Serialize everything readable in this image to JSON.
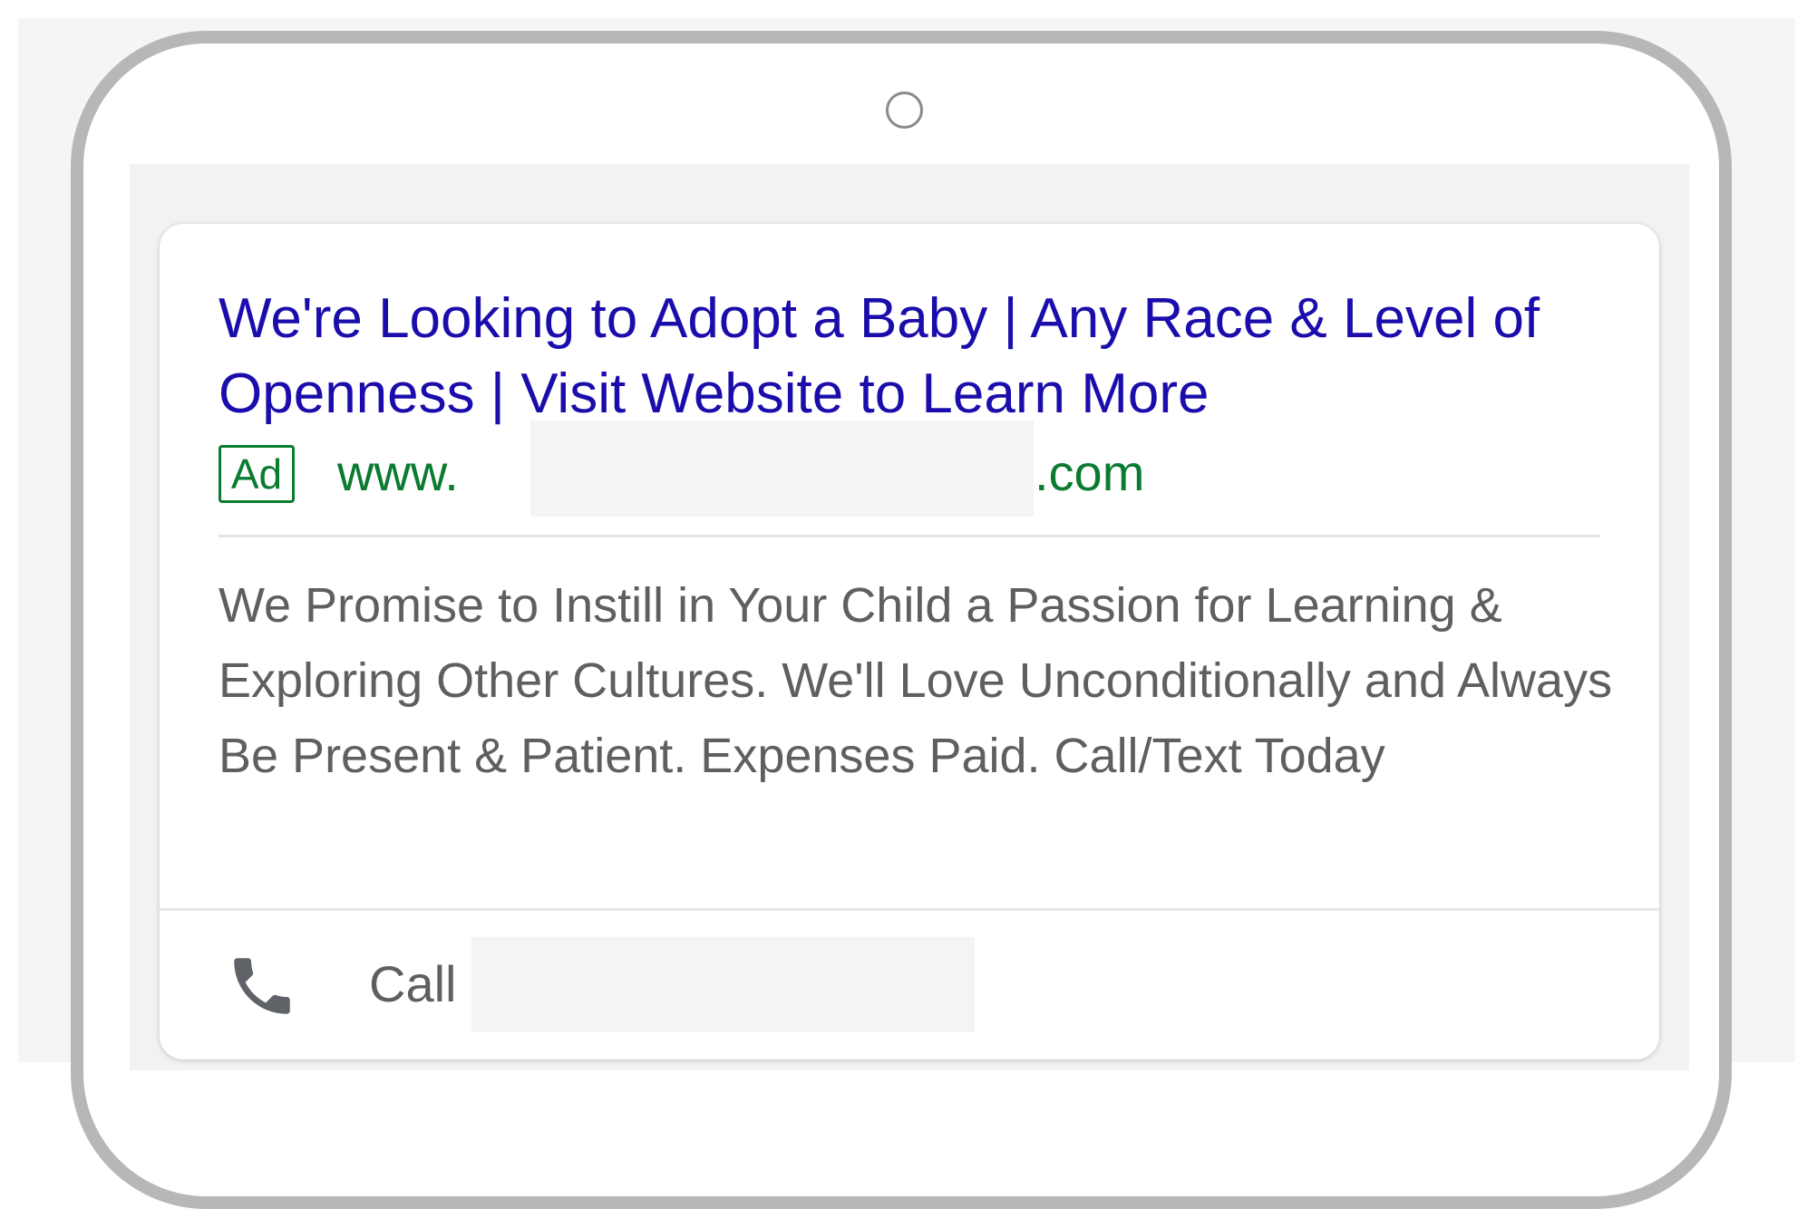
{
  "ad": {
    "headline": "We're Looking to Adopt a Baby | Any Race & Level of Openness | Visit Website to Learn More",
    "badge": "Ad",
    "display_url_prefix": "www.",
    "display_url_suffix": ".com",
    "description": "We Promise to Instill in Your Child a Passion for Learning & Exploring Other Cultures. We'll Love Unconditionally and Always Be Present & Patient. Expenses Paid. Call/Text Today",
    "call_label": "Call"
  },
  "colors": {
    "headline": "#1a0dab",
    "url": "#0a7b30",
    "body_text": "#5f5f5f",
    "phone_frame": "#b7b7b7"
  },
  "icons": {
    "phone": "phone-icon",
    "camera": "front-camera-icon"
  }
}
